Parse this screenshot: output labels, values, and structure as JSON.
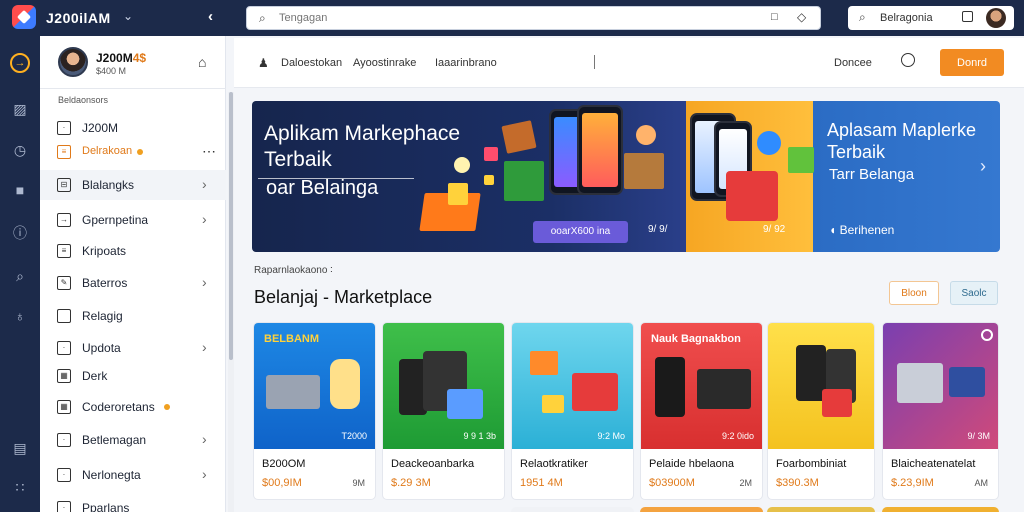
{
  "topbar": {
    "brand": "J200ilAM",
    "search_placeholder": "Tengagan",
    "search2_label": "Belragonia"
  },
  "sidebar": {
    "profile_name": "J200M",
    "profile_name_suffix": "4$",
    "profile_sub": "$400 M",
    "section_label": "Beldaonsors",
    "items": [
      {
        "label": "J200M",
        "icon": "square-icon"
      },
      {
        "label": "Delrakoan",
        "icon": "message-icon"
      },
      {
        "label": "Blalangks",
        "icon": "folder-icon"
      },
      {
        "label": "Gpernpetina",
        "icon": "arrow-box-icon"
      },
      {
        "label": "Kripoats",
        "icon": "chart-icon"
      },
      {
        "label": "Baterros",
        "icon": "edit-icon"
      },
      {
        "label": "Relagig",
        "icon": "square-icon"
      },
      {
        "label": "Updota",
        "icon": "upload-icon"
      },
      {
        "label": "Derk",
        "icon": "calendar-icon"
      },
      {
        "label": "Coderoretans",
        "icon": "grid-icon"
      },
      {
        "label": "Betlemagan",
        "icon": "square-icon"
      },
      {
        "label": "Nerlonegta",
        "icon": "book-icon"
      },
      {
        "label": "Pparlans",
        "icon": "tag-icon"
      }
    ]
  },
  "subheader": {
    "link1": "Daloestokan",
    "link2": "Ayoostinrake",
    "link3": "Iaaarinbrano",
    "right_link": "Doncee",
    "button": "Donrd"
  },
  "hero": {
    "title": "Aplikam Markephace Terbaik",
    "subtitle": "oar Belainga",
    "chip": "ooarX600 ina",
    "chip2": "9/ 9/",
    "yellow_note": "9/ 92",
    "title2": "Aplasam Maplerke Terbaik",
    "subtitle2": "Tarr Belanga",
    "link2": "Berihenen"
  },
  "section": {
    "breadcrumb": "Raparnlaokaono",
    "title": "Belanjaj - Marketplace",
    "btn_a": "Bloon",
    "btn_b": "Saolc"
  },
  "products": [
    {
      "name": "B200OM",
      "price": "$00,9IM",
      "meta": "9M",
      "tag": "T2000",
      "label": "BELBANM"
    },
    {
      "name": "Deackeoanbarka",
      "price": "$.29 3M",
      "meta": "",
      "tag": "9 9 1 3b",
      "label": ""
    },
    {
      "name": "Relaotkratiker",
      "price": "1951 4M",
      "meta": "",
      "tag": "9:2 Mo",
      "label": ""
    },
    {
      "name": "Pelaide hbelaona",
      "price": "$03900M",
      "meta": "2M",
      "tag": "9:2 0ido",
      "label": "Nauk Bagnakbon"
    },
    {
      "name": "Foarbombiniat",
      "price": "$390.3M",
      "meta": "",
      "tag": "",
      "label": ""
    },
    {
      "name": "Blaicheatenatelat",
      "price": "$.23,9IM",
      "meta": "AM",
      "tag": "9/ 3M",
      "label": ""
    }
  ]
}
